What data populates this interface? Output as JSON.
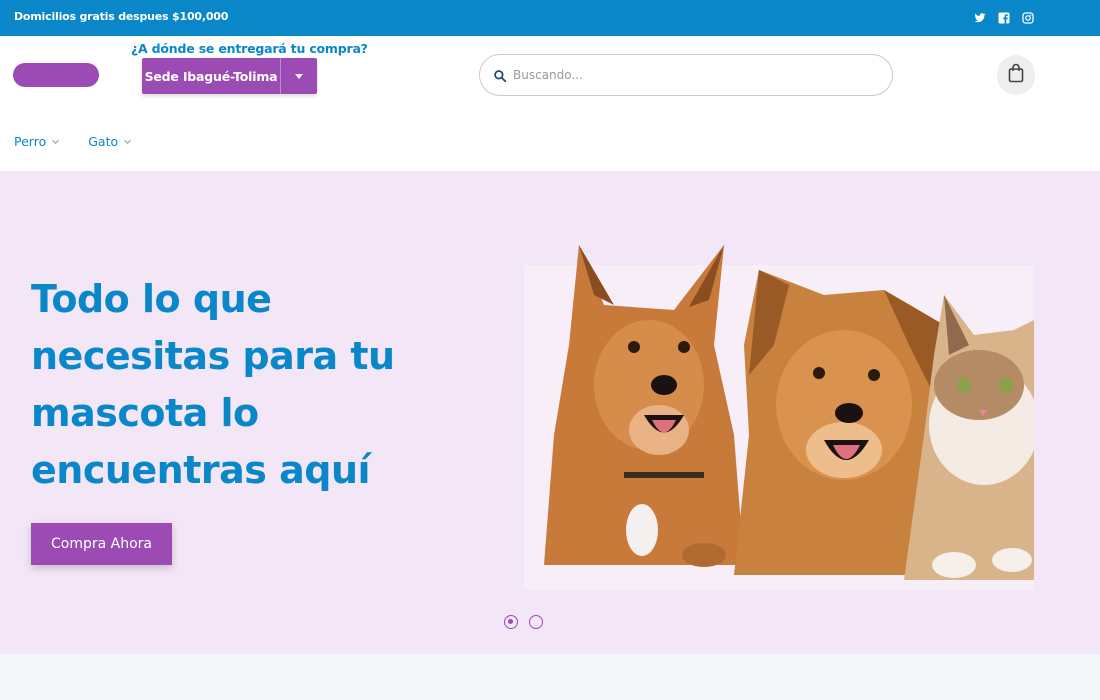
{
  "topbar": {
    "promo": "Domicilios gratis despues $100,000",
    "social_icons": [
      "twitter-icon",
      "facebook-icon",
      "instagram-icon"
    ]
  },
  "header": {
    "deliver_label": "¿A dónde se entregará tu compra?",
    "sede_selected": "Sede Ibagué-Tolima",
    "search_placeholder": "Buscando...",
    "cart_icon": "shopping-bag-icon"
  },
  "nav": {
    "items": [
      {
        "label": "Perro"
      },
      {
        "label": "Gato"
      }
    ]
  },
  "hero": {
    "title": "Todo lo que necesitas para tu mascota lo encuentras aquí",
    "button_label": "Compra Ahora",
    "slides_total": 2,
    "active_slide": 1
  },
  "colors": {
    "primary_blue": "#0a87c9",
    "purple": "#9b4bb3",
    "hero_bg": "#f3e6f6"
  }
}
